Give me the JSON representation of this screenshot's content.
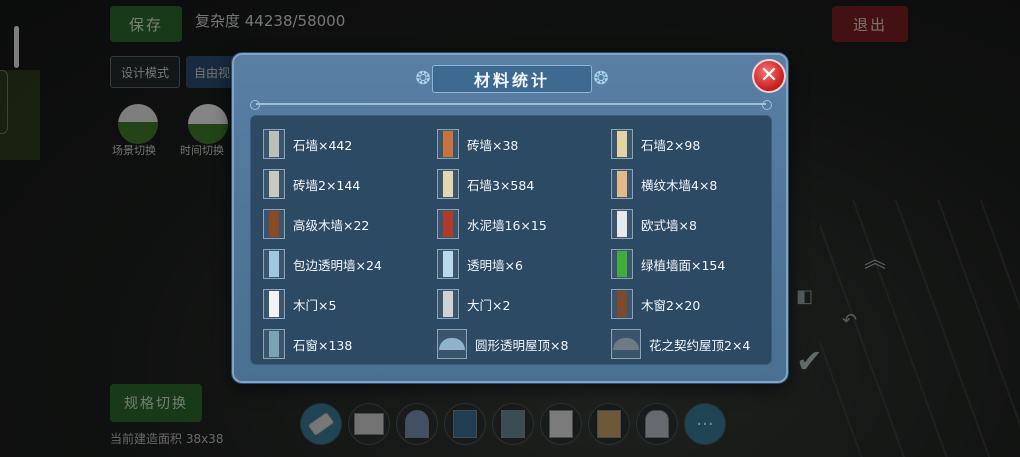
{
  "hud": {
    "save_label": "保存",
    "complexity": "复杂度 44238/58000",
    "exit_label": "退出",
    "design_mode_label": "设计模式",
    "free_mode_label": "自由视",
    "scene_switch_label": "场景切换",
    "time_switch_label": "时间切换",
    "plan_switch_label": "规格切换",
    "build_area_label": "当前建造面积 38x38"
  },
  "dialog": {
    "title": "材料统计",
    "close_label": "✕",
    "items": [
      {
        "label": "石墙×442",
        "color": "#b9c0b8"
      },
      {
        "label": "砖墙×38",
        "color": "#c8733f"
      },
      {
        "label": "石墙2×98",
        "color": "#e2d2a4"
      },
      {
        "label": "砖墙2×144",
        "color": "#c9c9c0"
      },
      {
        "label": "石墙3×584",
        "color": "#e6d6b0"
      },
      {
        "label": "横纹木墙4×8",
        "color": "#e3b98a"
      },
      {
        "label": "高级木墙×22",
        "color": "#8a4a25"
      },
      {
        "label": "水泥墙16×15",
        "color": "#b63a2a"
      },
      {
        "label": "欧式墙×8",
        "color": "#e7e9ea"
      },
      {
        "label": "包边透明墙×24",
        "color": "#9fc8e0"
      },
      {
        "label": "透明墙×6",
        "color": "#b9d9ec"
      },
      {
        "label": "绿植墙面×154",
        "color": "#3fae3a"
      },
      {
        "label": "木门×5",
        "color": "#f2f2f2"
      },
      {
        "label": "大门×2",
        "color": "#cfd3d6"
      },
      {
        "label": "木窗2×20",
        "color": "#7d4a2c"
      },
      {
        "label": "石窗×138",
        "color": "#7aa3b4"
      },
      {
        "label": "圆形透明屋顶×8",
        "color": "#8fb3c8"
      },
      {
        "label": "花之契约屋顶2×4",
        "color": "#6e7a84"
      }
    ]
  },
  "colors": {
    "modal_bg": "#5a7fa5",
    "panel_bg": "#2c4a63",
    "close_red": "#d42a2a",
    "save_green": "#2f6a2e",
    "exit_red": "#7a2020"
  }
}
